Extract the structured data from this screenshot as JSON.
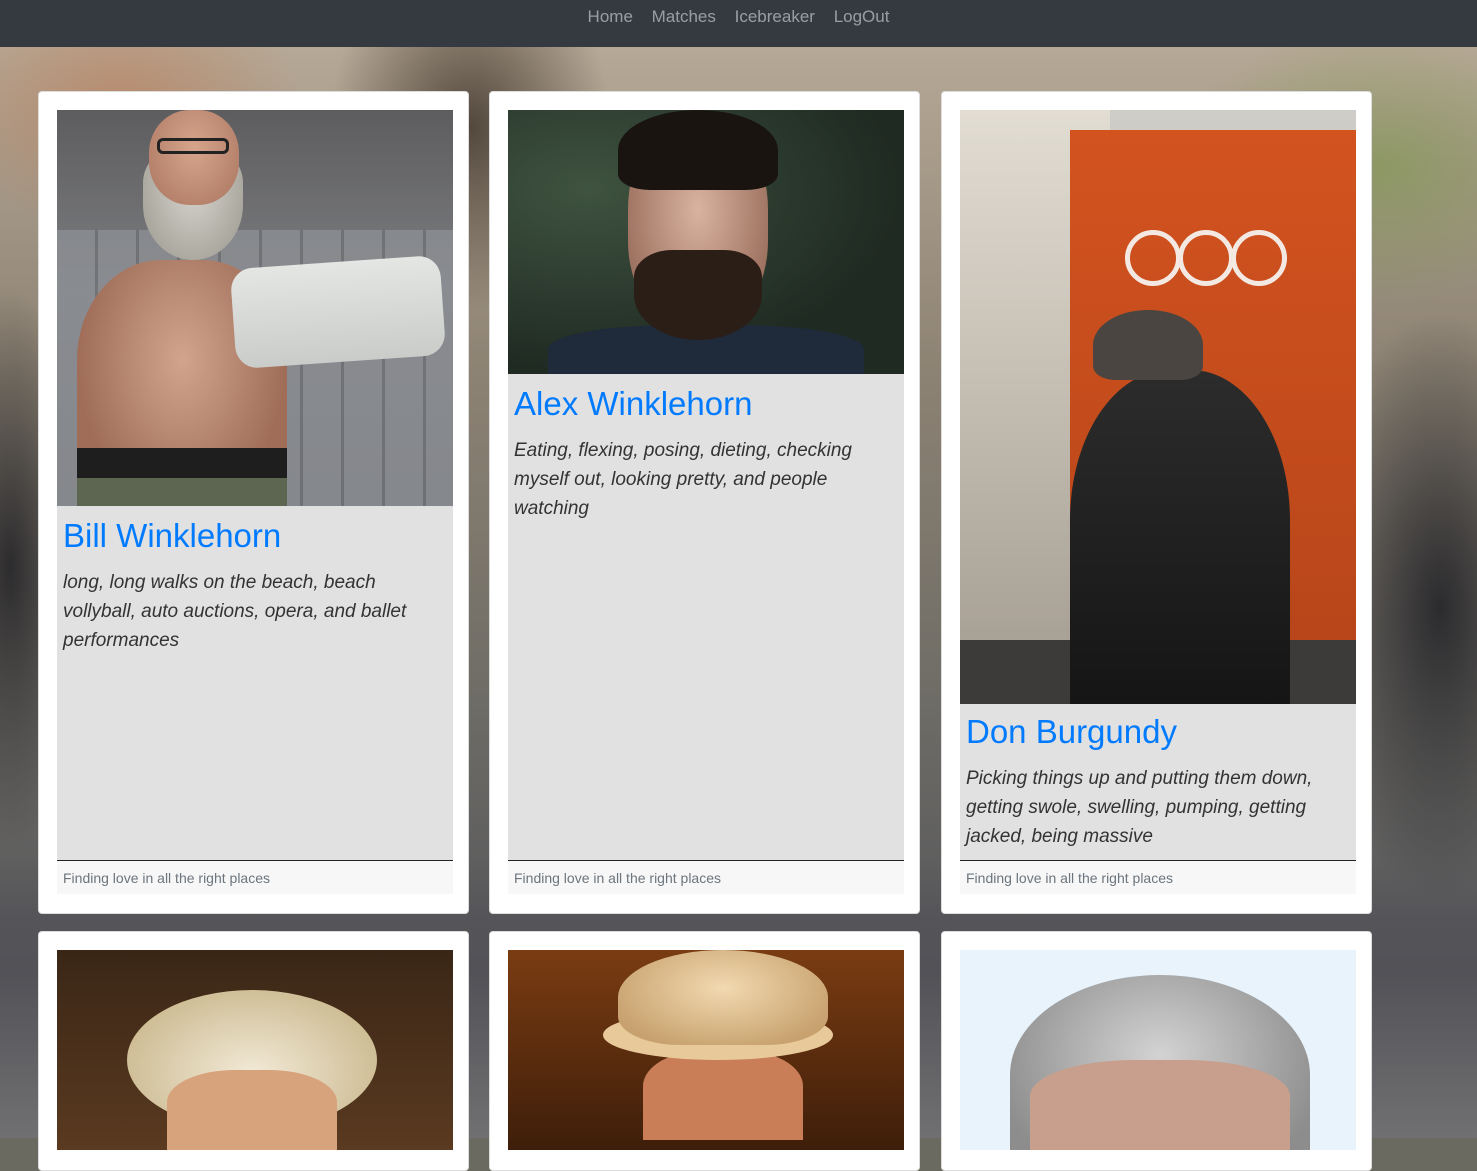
{
  "nav": {
    "items": [
      "Home",
      "Matches",
      "Icebreaker",
      "LogOut"
    ]
  },
  "cards": [
    {
      "name": "Bill Winklehorn",
      "interests": "long, long walks on the beach, beach vollyball, auto auctions, opera, and ballet performances",
      "footer": "Finding love in all the right places"
    },
    {
      "name": "Alex Winklehorn",
      "interests": "Eating, flexing, posing, dieting, checking myself out, looking pretty, and people watching",
      "footer": "Finding love in all the right places"
    },
    {
      "name": "Don Burgundy",
      "interests": "Picking things up and putting them down, getting swole, swelling, pumping, getting jacked, being massive",
      "footer": "Finding love in all the right places"
    }
  ],
  "colors": {
    "navbar": "#343a40",
    "link": "#007bff",
    "card_body": "#e1e1e1"
  }
}
